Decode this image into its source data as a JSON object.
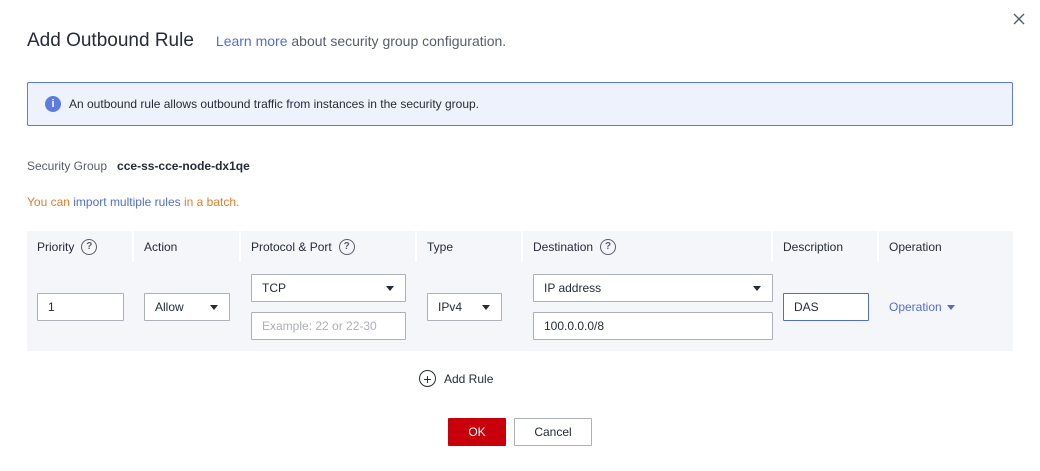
{
  "dialog": {
    "title": "Add Outbound Rule",
    "learn_more": "Learn more",
    "learn_more_suffix": " about security group configuration.",
    "close_icon": "close-icon"
  },
  "info": {
    "icon": "info-icon",
    "icon_glyph": "i",
    "text": "An outbound rule allows outbound traffic from instances in the security group."
  },
  "security_group": {
    "label": "Security Group",
    "value": "cce-ss-cce-node-dx1qe"
  },
  "batch": {
    "prefix": "You can ",
    "link": "import multiple rules",
    "suffix": " in a batch."
  },
  "table": {
    "help_glyph": "?",
    "headers": {
      "priority": "Priority",
      "action": "Action",
      "protocol_port": "Protocol & Port",
      "type": "Type",
      "destination": "Destination",
      "description": "Description",
      "operation": "Operation"
    },
    "row": {
      "priority": "1",
      "action": "Allow",
      "protocol": "TCP",
      "port_placeholder": "Example: 22 or 22-30",
      "type": "IPv4",
      "destination_type": "IP address",
      "destination_value": "100.0.0.0/8",
      "description": "DAS",
      "operation": "Operation"
    }
  },
  "add_rule": {
    "label": "Add Rule",
    "icon_glyph": "+"
  },
  "buttons": {
    "ok": "OK",
    "cancel": "Cancel"
  },
  "colors": {
    "primary_button": "#c7000b",
    "link": "#526ecc",
    "info_border": "#5e7ce0",
    "warning_text": "#e07d2c"
  }
}
